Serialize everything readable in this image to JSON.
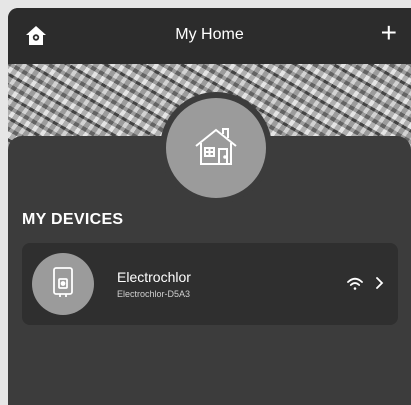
{
  "header": {
    "title": "My Home",
    "left_icon": "home-settings-icon",
    "right_icon": "plus-icon",
    "plus_label": "+"
  },
  "home": {
    "avatar_icon": "house-icon"
  },
  "devices_section": {
    "title": "MY DEVICES"
  },
  "devices": [
    {
      "name": "Electrochlor",
      "subtitle": "Electrochlor-D5A3",
      "icon": "water-heater-icon",
      "status_icon": "wifi-icon",
      "nav_icon": "chevron-right-icon"
    }
  ],
  "colors": {
    "header_bg": "#2c2c2c",
    "content_bg": "#3c3c3c",
    "card_bg": "#2f2f2f",
    "avatar_bg": "#9b9b9b",
    "text": "#ffffff"
  }
}
